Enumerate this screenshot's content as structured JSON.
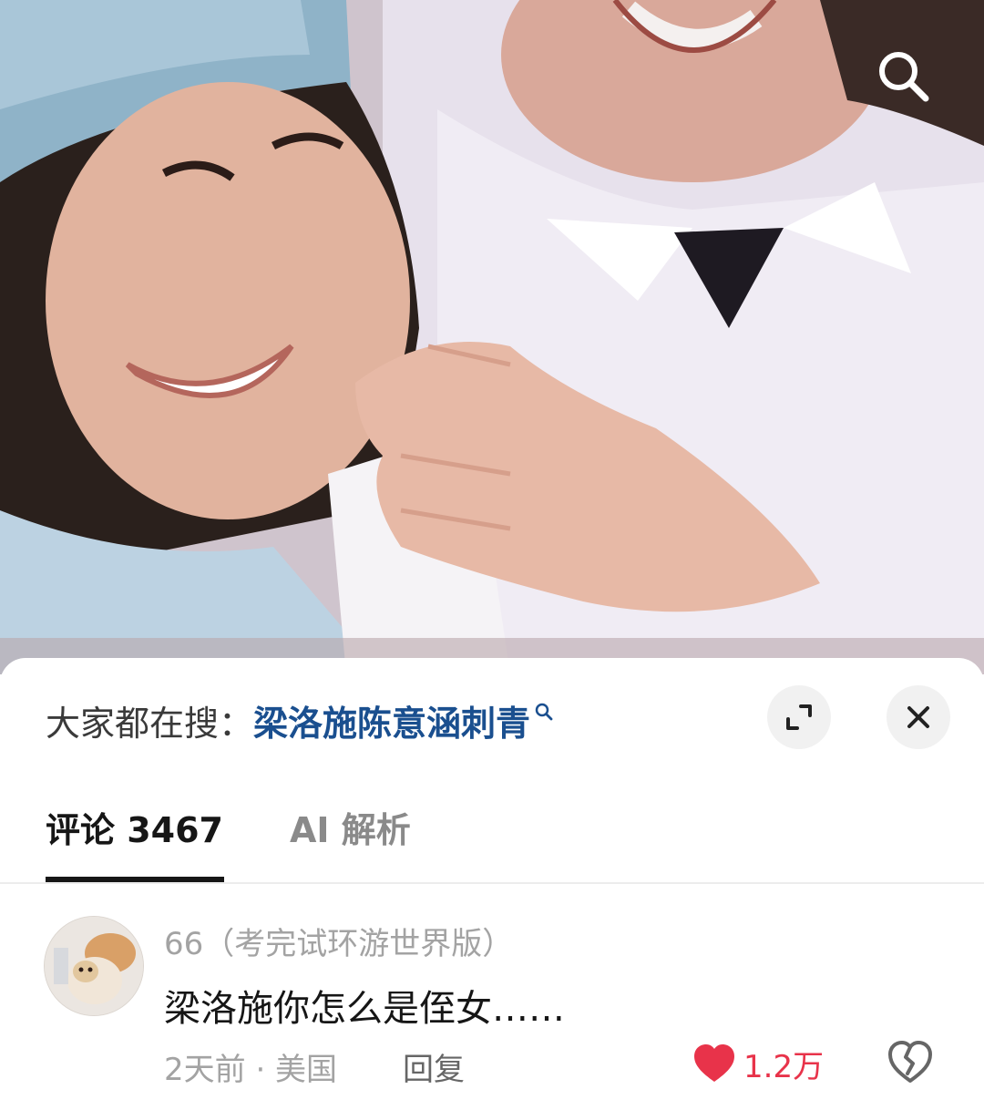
{
  "hot_search": {
    "prefix": "大家都在搜：",
    "term": "梁洛施陈意涵刺青"
  },
  "tabs": [
    {
      "label": "评论 3467",
      "active": true
    },
    {
      "label": "AI 解析",
      "active": false
    }
  ],
  "comment": {
    "username": "66（考完试环游世界版）",
    "text": "梁洛施你怎么是侄女……",
    "meta": "2天前 · 美国",
    "reply_label": "回复",
    "like_count": "1.2万"
  },
  "colors": {
    "accent_link": "#1a4f8f",
    "like_red": "#e8334a",
    "muted_text": "#a3a3a3"
  },
  "icons": [
    "search-icon",
    "expand-icon",
    "close-icon",
    "heart-icon",
    "broken-heart-icon"
  ]
}
